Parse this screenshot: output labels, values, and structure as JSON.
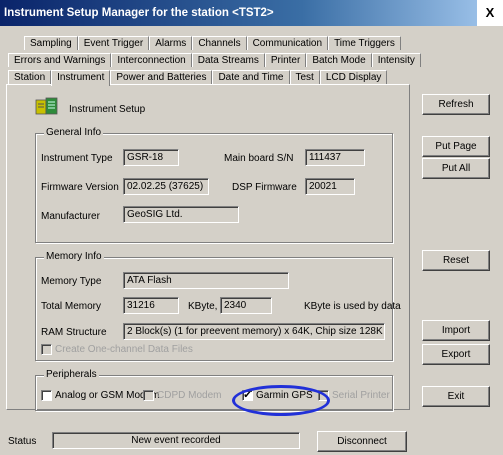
{
  "window": {
    "title": "Instrument Setup Manager for the station <TST2>",
    "close_label": "X"
  },
  "tabs": {
    "row1": [
      "Sampling",
      "Event Trigger",
      "Alarms",
      "Channels",
      "Communication",
      "Time Triggers"
    ],
    "row2": [
      "Errors and Warnings",
      "Interconnection",
      "Data Streams",
      "Printer",
      "Batch Mode",
      "Intensity"
    ],
    "row3": [
      "Station",
      "Instrument",
      "Power and Batteries",
      "Date and Time",
      "Test",
      "LCD Display"
    ],
    "active": "Instrument"
  },
  "header": {
    "icon": "instrument-icon",
    "title": "Instrument Setup"
  },
  "general_info": {
    "title": "General Info",
    "instrument_type_label": "Instrument Type",
    "instrument_type": "GSR-18",
    "main_board_label": "Main board S/N",
    "main_board": "111437",
    "firmware_label": "Firmware Version",
    "firmware": "02.02.25 (37625)",
    "dsp_label": "DSP Firmware",
    "dsp": "20021",
    "manufacturer_label": "Manufacturer",
    "manufacturer": "GeoSIG Ltd."
  },
  "memory_info": {
    "title": "Memory Info",
    "memory_type_label": "Memory Type",
    "memory_type": "ATA Flash",
    "total_label": "Total Memory",
    "total": "31216",
    "kbyte_label": "KByte,",
    "used": "2340",
    "used_label": "KByte is used by data",
    "ram_label": "RAM Structure",
    "ram": "2 Block(s) (1 for preevent memory) x 64K, Chip size 128K",
    "one_channel_label": "Create One-channel Data Files"
  },
  "peripherals": {
    "title": "Peripherals",
    "analog_gsm": "Analog or GSM Modem",
    "cdpd": "CDPD Modem",
    "garmin": "Garmin GPS",
    "serial_printer": "Serial Printer"
  },
  "buttons": {
    "refresh": "Refresh",
    "put_page": "Put Page",
    "put_all": "Put All",
    "reset": "Reset",
    "import": "Import",
    "export": "Export",
    "exit": "Exit"
  },
  "status": {
    "label": "Status",
    "message": "New event recorded",
    "disconnect": "Disconnect"
  },
  "colors": {
    "annotation_circle": "#2130d8"
  }
}
